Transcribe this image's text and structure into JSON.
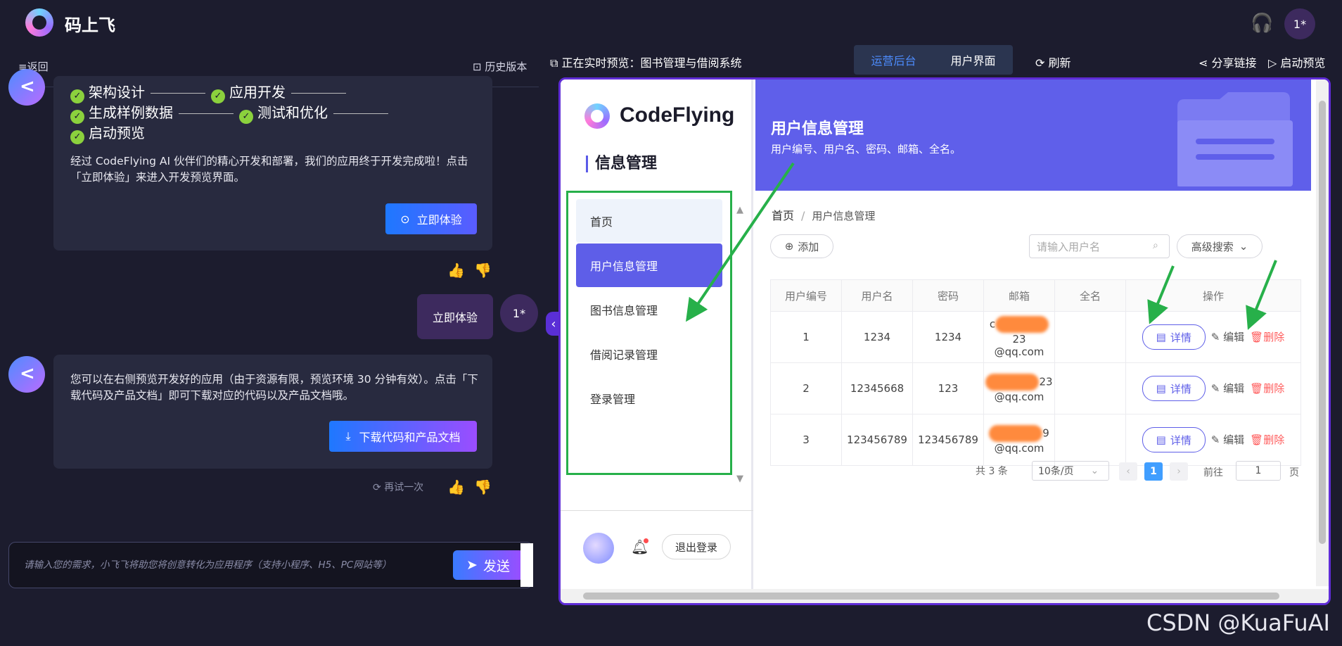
{
  "topbar": {
    "app_title": "码上飞",
    "user_avatar": "1*"
  },
  "nav": {
    "back": "≡返回",
    "history": "历史版本"
  },
  "chat": {
    "steps": [
      "架构设计",
      "应用开发",
      "生成样例数据",
      "测试和优化",
      "启动预览"
    ],
    "message1": "经过 CodeFlying AI 伙伴们的精心开发和部署，我们的应用终于开发完成啦！点击「立即体验」来进入开发预览界面。",
    "try_now": "立即体验",
    "user_message": "立即体验",
    "user_avatar": "1*",
    "message2": "您可以在右侧预览开发好的应用（由于资源有限，预览环境 30 分钟有效）。点击「下载代码及产品文档」即可下载对应的代码以及产品文档哦。",
    "download": "下载代码和产品文档",
    "retry": "再试一次"
  },
  "composer": {
    "placeholder": "请输入您的需求，小飞飞将助您将创意转化为应用程序（支持小程序、H5、PC网站等）",
    "send": "发送"
  },
  "preview": {
    "label": "正在实时预览：图书管理与借阅系统",
    "seg_admin": "运营后台",
    "seg_user": "用户界面",
    "refresh": "刷新",
    "share": "分享链接",
    "start": "启动预览"
  },
  "app": {
    "brand": "CodeFlying",
    "section": "信息管理",
    "menu": [
      "首页",
      "用户信息管理",
      "图书信息管理",
      "借阅记录管理",
      "登录管理"
    ],
    "logout": "退出登录",
    "banner_title": "用户信息管理",
    "banner_sub": "用户编号、用户名、密码、邮箱、全名。",
    "breadcrumb_home": "首页",
    "breadcrumb_sep": "/",
    "breadcrumb_current": "用户信息管理",
    "add": "添加",
    "search_placeholder": "请输入用户名",
    "advanced": "高级搜索",
    "columns": [
      "用户编号",
      "用户名",
      "密码",
      "邮箱",
      "全名",
      "操作"
    ],
    "rows": [
      {
        "id": "1",
        "username": "1234",
        "password": "1234",
        "email_start": "c",
        "email_mid": "23",
        "email_end": "@qq.com",
        "fullname": ""
      },
      {
        "id": "2",
        "username": "12345668",
        "password": "123",
        "email_start": "",
        "email_mid": "23",
        "email_end": "@qq.com",
        "fullname": ""
      },
      {
        "id": "3",
        "username": "123456789",
        "password": "123456789",
        "email_start": "",
        "email_mid": "9",
        "email_end": "@qq.com",
        "fullname": ""
      }
    ],
    "detail": "详情",
    "edit": "编辑",
    "delete": "删除",
    "total": "共 3 条",
    "page_size": "10条/页",
    "current_page": "1",
    "goto": "前往",
    "goto_value": "1",
    "page_unit": "页"
  },
  "watermark": "CSDN @KuaFuAI",
  "colors": {
    "accent": "#5e5ee8",
    "arrow": "#27b04a",
    "danger": "#ff5b5b",
    "frame": "#5f2cd6"
  }
}
